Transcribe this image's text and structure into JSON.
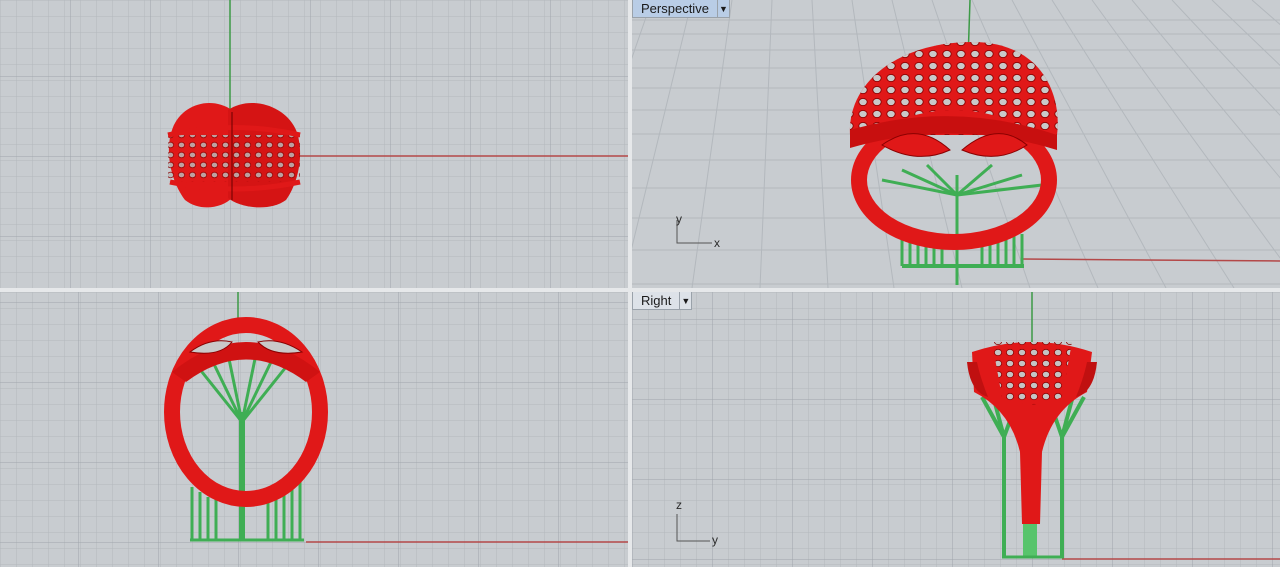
{
  "viewports": {
    "perspective": {
      "label": "Perspective",
      "axes": {
        "x": "x",
        "y": "y"
      }
    },
    "right": {
      "label": "Right",
      "axes": {
        "z": "z",
        "y": "y"
      }
    }
  },
  "icons": {
    "dropdown": "chevron-down-icon"
  },
  "colors": {
    "background": "#c8ccd0",
    "grid_minor": "#b3b8bd",
    "grid_major": "#9fa5ab",
    "model": "#e01818",
    "supports": "#3fae54",
    "x_axis": "#b44848",
    "y_axis": "#3c9a46"
  }
}
